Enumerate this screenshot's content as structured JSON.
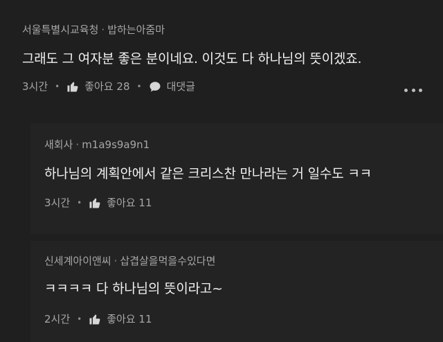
{
  "comments": [
    {
      "author": "서울특별시교육청",
      "reply_to": "밥하는아줌마",
      "text": "그래도 그 여자분 좋은 분이네요. 이것도 다 하나님의 뜻이겠죠.",
      "time": "3시간",
      "likes_label": "좋아요 28",
      "reply_label": "대댓글"
    },
    {
      "author": "새회사",
      "reply_to": "m1a9s9a9n1",
      "text": "하나님의 계획안에서 같은 크리스찬 만나라는 거 일수도 ㅋㅋ",
      "time": "3시간",
      "likes_label": "좋아요 11"
    },
    {
      "author": "신세계아이앤씨",
      "reply_to": "삽겹살을먹을수있다면",
      "text": "ㅋㅋㅋㅋ 다 하나님의 뜻이라고~",
      "time": "2시간",
      "likes_label": "좋아요 11"
    }
  ],
  "separator": "·",
  "icons": {
    "like": "thumbs-up-icon",
    "reply": "speech-bubble-icon",
    "more": "more-dots-icon"
  }
}
